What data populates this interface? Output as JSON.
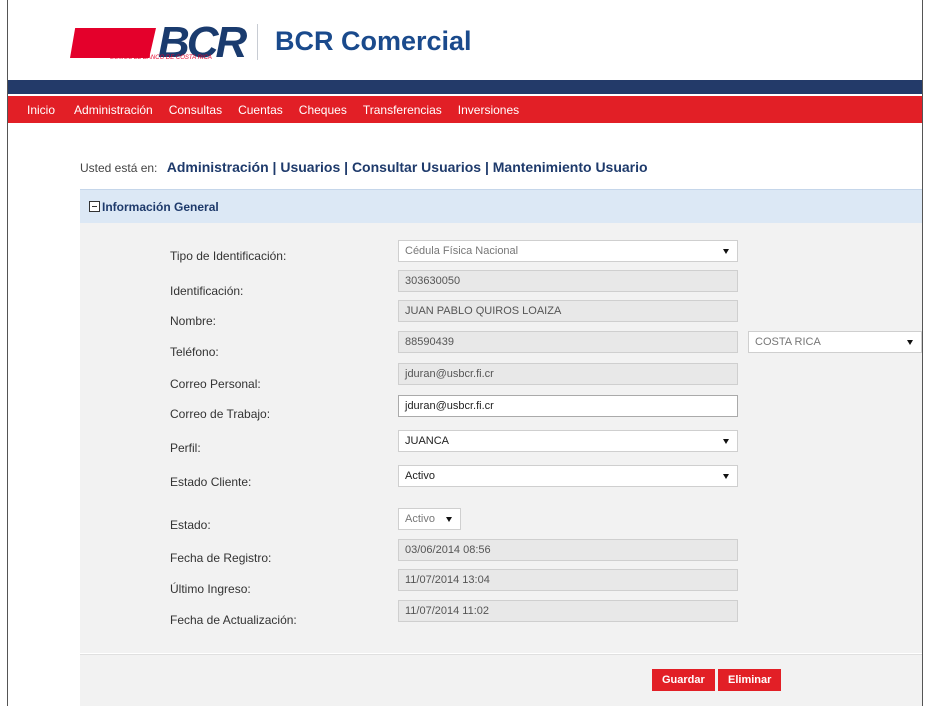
{
  "brand": {
    "logo_text": "BCR",
    "logo_tagline": "SOMOS EL BANCO DE COSTA RICA",
    "app_title": "BCR Comercial",
    "colors": {
      "red": "#e21f26",
      "navy": "#233a69",
      "panel": "#dce8f5"
    }
  },
  "nav": {
    "items": [
      {
        "label": "Inicio"
      },
      {
        "label": "Administración"
      },
      {
        "label": "Consultas"
      },
      {
        "label": "Cuentas"
      },
      {
        "label": "Cheques"
      },
      {
        "label": "Transferencias"
      },
      {
        "label": "Inversiones"
      }
    ]
  },
  "breadcrumb": {
    "prefix": "Usted está en:",
    "path": "Administración | Usuarios | Consultar Usuarios | Mantenimiento Usuario"
  },
  "panel": {
    "title": "Información General",
    "toggle_icon": "collapse-minus-icon"
  },
  "form": {
    "tipo_id": {
      "label": "Tipo de Identificación:",
      "value": "Cédula Física Nacional"
    },
    "identificacion": {
      "label": "Identificación:",
      "value": "303630050"
    },
    "nombre": {
      "label": "Nombre:",
      "value": "JUAN PABLO QUIROS LOAIZA"
    },
    "telefono": {
      "label": "Teléfono:",
      "value": "88590439",
      "country": "COSTA RICA"
    },
    "correo_personal": {
      "label": "Correo Personal:",
      "value": "jduran@usbcr.fi.cr"
    },
    "correo_trabajo": {
      "label": "Correo de Trabajo:",
      "value": "jduran@usbcr.fi.cr"
    },
    "perfil": {
      "label": "Perfil:",
      "value": "JUANCA"
    },
    "estado_cliente": {
      "label": "Estado Cliente:",
      "value": "Activo"
    },
    "estado": {
      "label": "Estado:",
      "value": "Activo"
    },
    "fecha_registro": {
      "label": "Fecha de Registro:",
      "value": "03/06/2014 08:56"
    },
    "ultimo_ingreso": {
      "label": "Último Ingreso:",
      "value": "11/07/2014 13:04"
    },
    "fecha_actualizacion": {
      "label": "Fecha de Actualización:",
      "value": "11/07/2014 11:02"
    }
  },
  "actions": {
    "save_label": "Guardar",
    "delete_label": "Eliminar"
  }
}
